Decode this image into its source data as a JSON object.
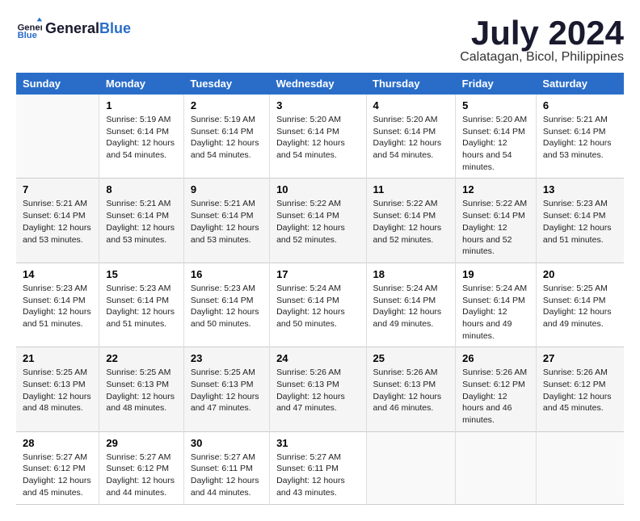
{
  "logo": {
    "text_general": "General",
    "text_blue": "Blue"
  },
  "title": "July 2024",
  "subtitle": "Calatagan, Bicol, Philippines",
  "header": {
    "days": [
      "Sunday",
      "Monday",
      "Tuesday",
      "Wednesday",
      "Thursday",
      "Friday",
      "Saturday"
    ]
  },
  "weeks": [
    [
      {
        "num": "",
        "sunrise": "",
        "sunset": "",
        "daylight": ""
      },
      {
        "num": "1",
        "sunrise": "Sunrise: 5:19 AM",
        "sunset": "Sunset: 6:14 PM",
        "daylight": "Daylight: 12 hours and 54 minutes."
      },
      {
        "num": "2",
        "sunrise": "Sunrise: 5:19 AM",
        "sunset": "Sunset: 6:14 PM",
        "daylight": "Daylight: 12 hours and 54 minutes."
      },
      {
        "num": "3",
        "sunrise": "Sunrise: 5:20 AM",
        "sunset": "Sunset: 6:14 PM",
        "daylight": "Daylight: 12 hours and 54 minutes."
      },
      {
        "num": "4",
        "sunrise": "Sunrise: 5:20 AM",
        "sunset": "Sunset: 6:14 PM",
        "daylight": "Daylight: 12 hours and 54 minutes."
      },
      {
        "num": "5",
        "sunrise": "Sunrise: 5:20 AM",
        "sunset": "Sunset: 6:14 PM",
        "daylight": "Daylight: 12 hours and 54 minutes."
      },
      {
        "num": "6",
        "sunrise": "Sunrise: 5:21 AM",
        "sunset": "Sunset: 6:14 PM",
        "daylight": "Daylight: 12 hours and 53 minutes."
      }
    ],
    [
      {
        "num": "7",
        "sunrise": "Sunrise: 5:21 AM",
        "sunset": "Sunset: 6:14 PM",
        "daylight": "Daylight: 12 hours and 53 minutes."
      },
      {
        "num": "8",
        "sunrise": "Sunrise: 5:21 AM",
        "sunset": "Sunset: 6:14 PM",
        "daylight": "Daylight: 12 hours and 53 minutes."
      },
      {
        "num": "9",
        "sunrise": "Sunrise: 5:21 AM",
        "sunset": "Sunset: 6:14 PM",
        "daylight": "Daylight: 12 hours and 53 minutes."
      },
      {
        "num": "10",
        "sunrise": "Sunrise: 5:22 AM",
        "sunset": "Sunset: 6:14 PM",
        "daylight": "Daylight: 12 hours and 52 minutes."
      },
      {
        "num": "11",
        "sunrise": "Sunrise: 5:22 AM",
        "sunset": "Sunset: 6:14 PM",
        "daylight": "Daylight: 12 hours and 52 minutes."
      },
      {
        "num": "12",
        "sunrise": "Sunrise: 5:22 AM",
        "sunset": "Sunset: 6:14 PM",
        "daylight": "Daylight: 12 hours and 52 minutes."
      },
      {
        "num": "13",
        "sunrise": "Sunrise: 5:23 AM",
        "sunset": "Sunset: 6:14 PM",
        "daylight": "Daylight: 12 hours and 51 minutes."
      }
    ],
    [
      {
        "num": "14",
        "sunrise": "Sunrise: 5:23 AM",
        "sunset": "Sunset: 6:14 PM",
        "daylight": "Daylight: 12 hours and 51 minutes."
      },
      {
        "num": "15",
        "sunrise": "Sunrise: 5:23 AM",
        "sunset": "Sunset: 6:14 PM",
        "daylight": "Daylight: 12 hours and 51 minutes."
      },
      {
        "num": "16",
        "sunrise": "Sunrise: 5:23 AM",
        "sunset": "Sunset: 6:14 PM",
        "daylight": "Daylight: 12 hours and 50 minutes."
      },
      {
        "num": "17",
        "sunrise": "Sunrise: 5:24 AM",
        "sunset": "Sunset: 6:14 PM",
        "daylight": "Daylight: 12 hours and 50 minutes."
      },
      {
        "num": "18",
        "sunrise": "Sunrise: 5:24 AM",
        "sunset": "Sunset: 6:14 PM",
        "daylight": "Daylight: 12 hours and 49 minutes."
      },
      {
        "num": "19",
        "sunrise": "Sunrise: 5:24 AM",
        "sunset": "Sunset: 6:14 PM",
        "daylight": "Daylight: 12 hours and 49 minutes."
      },
      {
        "num": "20",
        "sunrise": "Sunrise: 5:25 AM",
        "sunset": "Sunset: 6:14 PM",
        "daylight": "Daylight: 12 hours and 49 minutes."
      }
    ],
    [
      {
        "num": "21",
        "sunrise": "Sunrise: 5:25 AM",
        "sunset": "Sunset: 6:13 PM",
        "daylight": "Daylight: 12 hours and 48 minutes."
      },
      {
        "num": "22",
        "sunrise": "Sunrise: 5:25 AM",
        "sunset": "Sunset: 6:13 PM",
        "daylight": "Daylight: 12 hours and 48 minutes."
      },
      {
        "num": "23",
        "sunrise": "Sunrise: 5:25 AM",
        "sunset": "Sunset: 6:13 PM",
        "daylight": "Daylight: 12 hours and 47 minutes."
      },
      {
        "num": "24",
        "sunrise": "Sunrise: 5:26 AM",
        "sunset": "Sunset: 6:13 PM",
        "daylight": "Daylight: 12 hours and 47 minutes."
      },
      {
        "num": "25",
        "sunrise": "Sunrise: 5:26 AM",
        "sunset": "Sunset: 6:13 PM",
        "daylight": "Daylight: 12 hours and 46 minutes."
      },
      {
        "num": "26",
        "sunrise": "Sunrise: 5:26 AM",
        "sunset": "Sunset: 6:12 PM",
        "daylight": "Daylight: 12 hours and 46 minutes."
      },
      {
        "num": "27",
        "sunrise": "Sunrise: 5:26 AM",
        "sunset": "Sunset: 6:12 PM",
        "daylight": "Daylight: 12 hours and 45 minutes."
      }
    ],
    [
      {
        "num": "28",
        "sunrise": "Sunrise: 5:27 AM",
        "sunset": "Sunset: 6:12 PM",
        "daylight": "Daylight: 12 hours and 45 minutes."
      },
      {
        "num": "29",
        "sunrise": "Sunrise: 5:27 AM",
        "sunset": "Sunset: 6:12 PM",
        "daylight": "Daylight: 12 hours and 44 minutes."
      },
      {
        "num": "30",
        "sunrise": "Sunrise: 5:27 AM",
        "sunset": "Sunset: 6:11 PM",
        "daylight": "Daylight: 12 hours and 44 minutes."
      },
      {
        "num": "31",
        "sunrise": "Sunrise: 5:27 AM",
        "sunset": "Sunset: 6:11 PM",
        "daylight": "Daylight: 12 hours and 43 minutes."
      },
      {
        "num": "",
        "sunrise": "",
        "sunset": "",
        "daylight": ""
      },
      {
        "num": "",
        "sunrise": "",
        "sunset": "",
        "daylight": ""
      },
      {
        "num": "",
        "sunrise": "",
        "sunset": "",
        "daylight": ""
      }
    ]
  ]
}
